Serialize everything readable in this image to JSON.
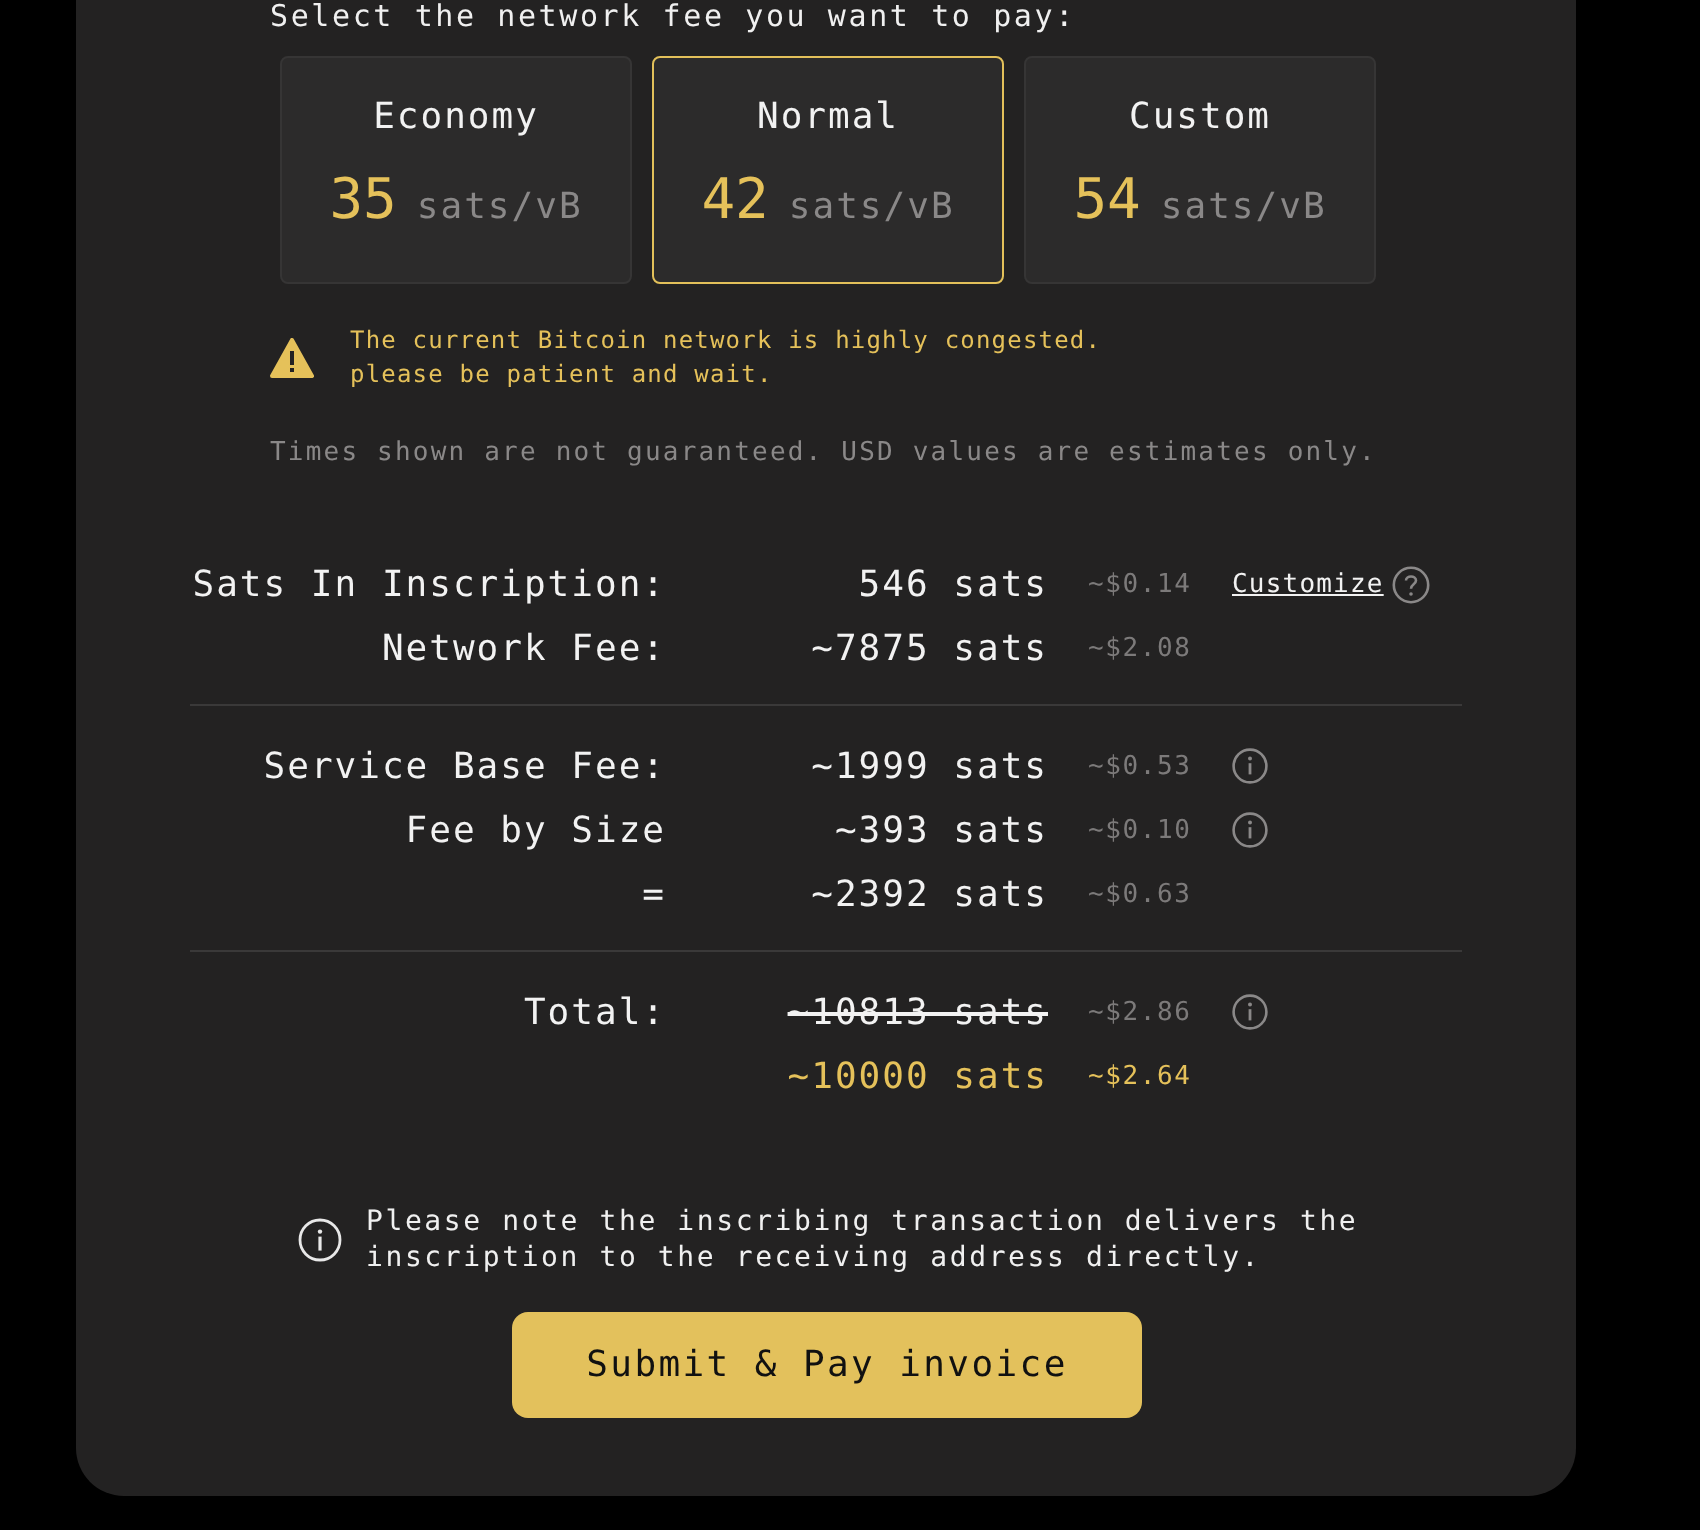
{
  "heading": "Select the network fee you want to pay:",
  "fee_options": [
    {
      "label": "Economy",
      "rate": "35",
      "unit": "sats/vB",
      "selected": false
    },
    {
      "label": "Normal",
      "rate": "42",
      "unit": "sats/vB",
      "selected": true
    },
    {
      "label": "Custom",
      "rate": "54",
      "unit": "sats/vB",
      "selected": false
    }
  ],
  "warning": {
    "lines": [
      "The current Bitcoin network is highly congested.",
      "please be patient and wait."
    ]
  },
  "disclaimer": "Times shown are not guaranteed. USD values are estimates only.",
  "sections": [
    {
      "rows": [
        {
          "kind": "plain",
          "label": "Sats In Inscription:",
          "value": "546 sats",
          "usd": "~$0.14",
          "link": "Customize",
          "info": false
        },
        {
          "kind": "plain",
          "label": "Network Fee:",
          "value": "~7875 sats",
          "usd": "~$2.08",
          "info": false
        }
      ]
    },
    {
      "rows": [
        {
          "kind": "plain",
          "label": "Service Base Fee:",
          "value": "~1999 sats",
          "usd": "~$0.53",
          "info": true
        },
        {
          "kind": "plain",
          "label": "Fee by Size",
          "value": "~393 sats",
          "usd": "~$0.10",
          "info": true
        },
        {
          "kind": "plain",
          "label": "=",
          "value": "~2392 sats",
          "usd": "~$0.63",
          "info": false
        }
      ]
    },
    {
      "rows": [
        {
          "kind": "strike",
          "label": "Total:",
          "value": "~10813 sats",
          "usd": "~$2.86",
          "info": true
        },
        {
          "kind": "highlight",
          "value": "~10000 sats",
          "usd": "~$2.64",
          "info": false
        }
      ]
    }
  ],
  "note": "Please note the inscribing transaction delivers the inscription to the receiving address directly.",
  "button": "Submit & Pay invoice"
}
